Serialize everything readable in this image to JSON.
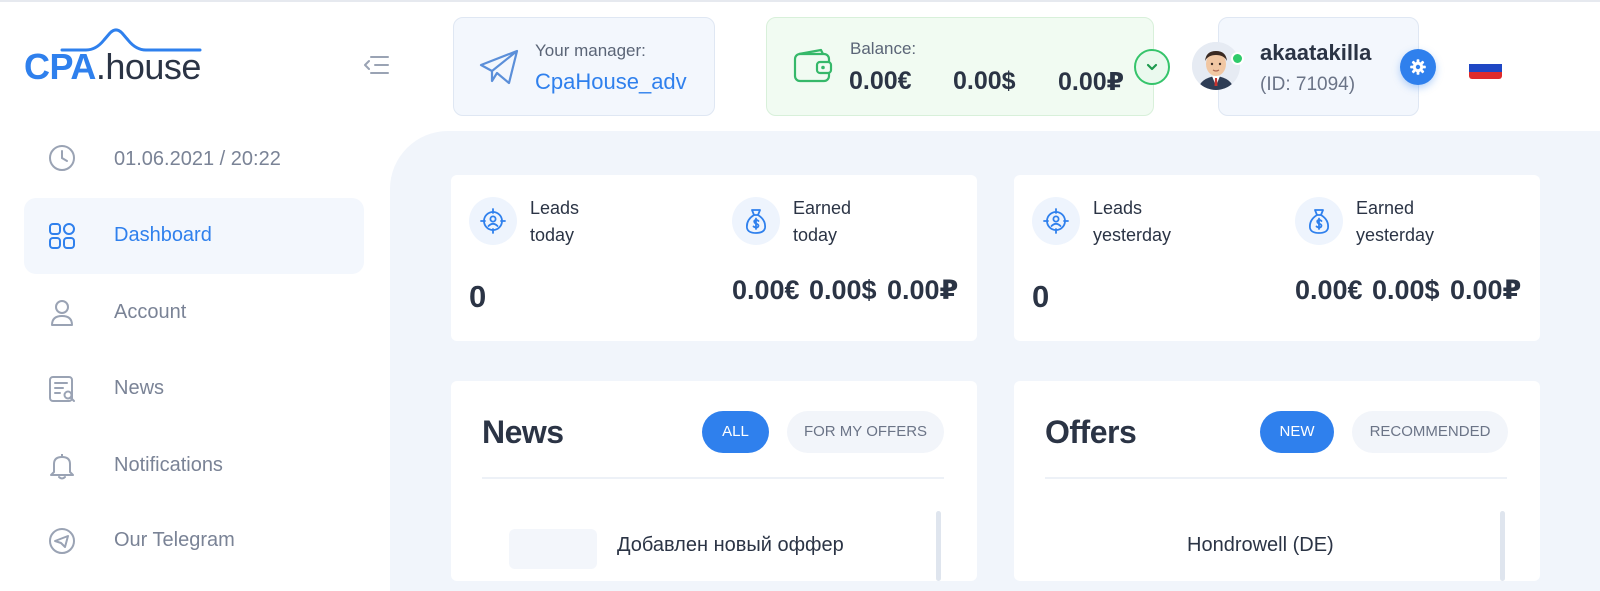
{
  "brand": {
    "logo_cpa": "CPA",
    "logo_house": ".house",
    "accent": "#2f80ed"
  },
  "header": {
    "manager_label": "Your manager:",
    "manager_name": "CpaHouse_adv",
    "balance_label": "Balance:",
    "balance_eur": "0.00€",
    "balance_usd": "0.00$",
    "balance_rub": "0.00₽",
    "username": "akaatakilla",
    "user_id": "(ID: 71094)",
    "language_flag": "russia-flag"
  },
  "sidebar": {
    "datetime": "01.06.2021 / 20:22",
    "items": [
      {
        "label": "Dashboard",
        "icon": "dashboard-grid-icon",
        "active": true
      },
      {
        "label": "Account",
        "icon": "user-icon",
        "active": false
      },
      {
        "label": "News",
        "icon": "news-list-icon",
        "active": false
      },
      {
        "label": "Notifications",
        "icon": "bell-icon",
        "active": false
      },
      {
        "label": "Our Telegram",
        "icon": "telegram-icon",
        "active": false
      }
    ]
  },
  "stats": {
    "today": {
      "leads_label_1": "Leads",
      "leads_label_2": "today",
      "earned_label_1": "Earned",
      "earned_label_2": "today",
      "leads_value": "0",
      "earned_eur": "0.00€",
      "earned_usd": "0.00$",
      "earned_rub": "0.00₽"
    },
    "yesterday": {
      "leads_label_1": "Leads",
      "leads_label_2": "yesterday",
      "earned_label_1": "Earned",
      "earned_label_2": "yesterday",
      "leads_value": "0",
      "earned_eur": "0.00€",
      "earned_usd": "0.00$",
      "earned_rub": "0.00₽"
    }
  },
  "news_panel": {
    "title": "News",
    "tab_all": "ALL",
    "tab_my_offers": "FOR MY OFFERS",
    "first_item": "Добавлен новый оффер"
  },
  "offers_panel": {
    "title": "Offers",
    "tab_new": "NEW",
    "tab_recommended": "RECOMMENDED",
    "first_item": "Hondrowell (DE)"
  }
}
